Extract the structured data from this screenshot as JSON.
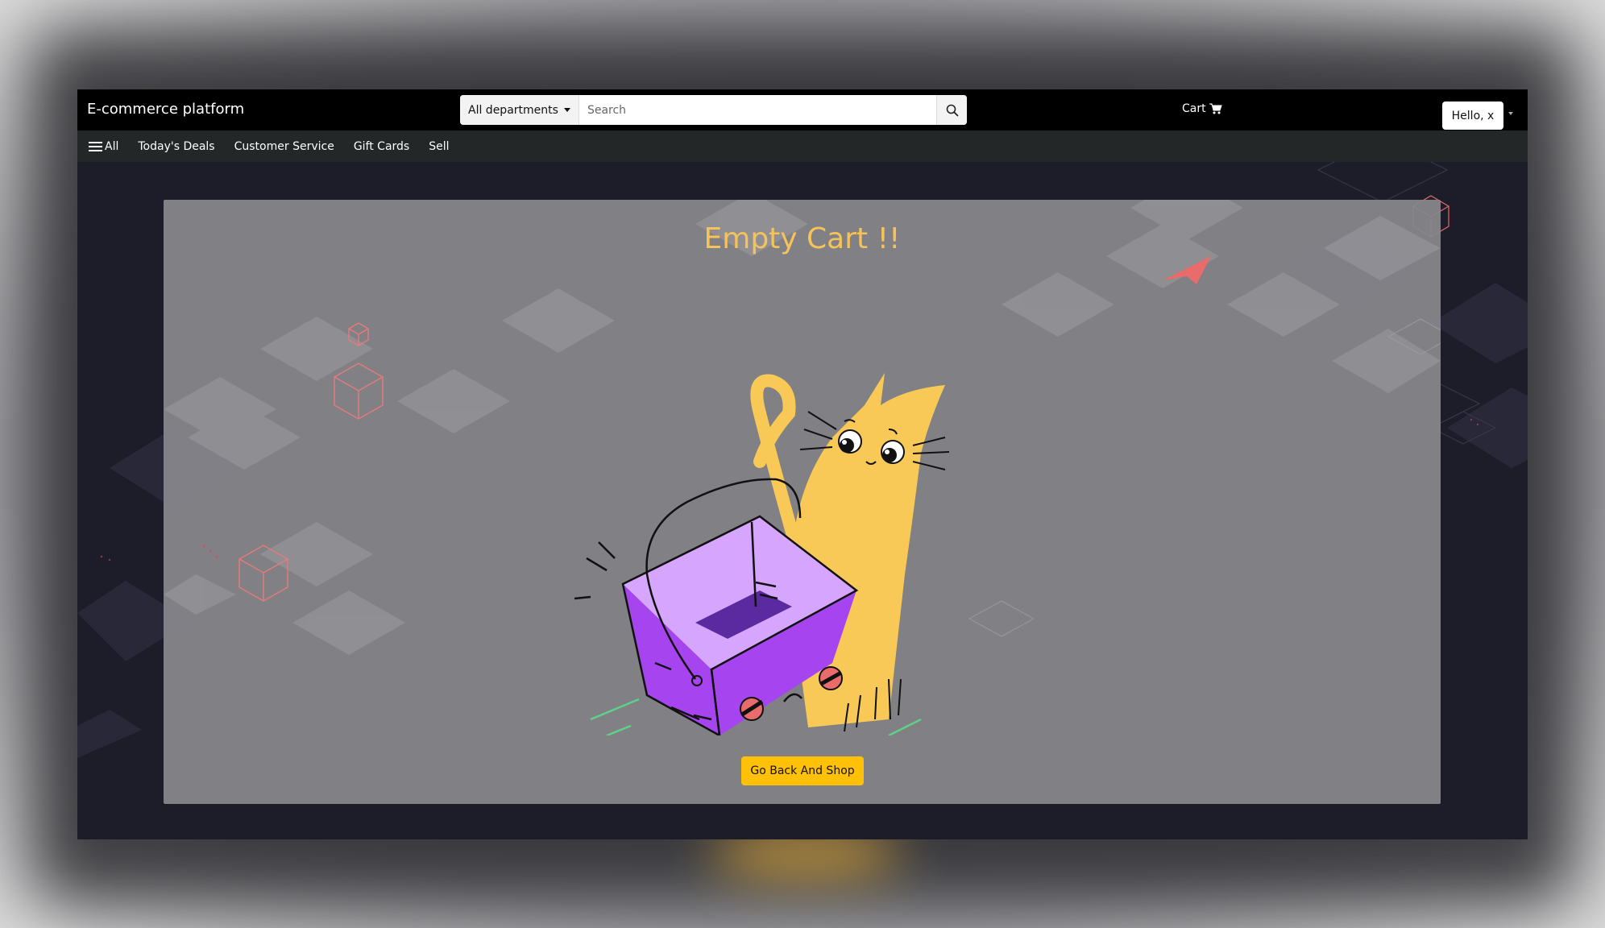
{
  "header": {
    "brand": "E-commerce platform",
    "department_label": "All departments",
    "search_placeholder": "Search",
    "cart_label": "Cart",
    "account_label": "Hello, x"
  },
  "nav": {
    "items": [
      {
        "label": "All"
      },
      {
        "label": "Today's Deals"
      },
      {
        "label": "Customer Service"
      },
      {
        "label": "Gift Cards"
      },
      {
        "label": "Sell"
      }
    ]
  },
  "main": {
    "title": "Empty Cart !!",
    "cta_label": "Go Back And Shop"
  },
  "colors": {
    "title": "#f6c35a",
    "cta": "#ffc107",
    "basket": "#a645f0",
    "cat": "#f8c956"
  }
}
